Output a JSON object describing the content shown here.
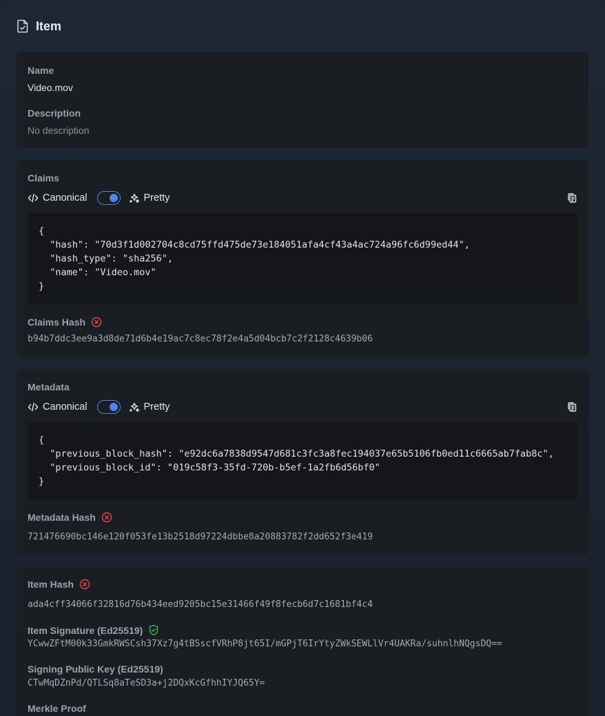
{
  "header": {
    "title": "Item",
    "icon": "file-check-icon"
  },
  "info": {
    "name_label": "Name",
    "name_value": "Video.mov",
    "description_label": "Description",
    "description_value": "No description"
  },
  "claims": {
    "section_label": "Claims",
    "canonical_label": "Canonical",
    "pretty_label": "Pretty",
    "toggle_on": true,
    "json_text": "{\n  \"hash\": \"70d3f1d002704c8cd75ffd475de73e184051afa4cf43a4ac724a96fc6d99ed44\",\n  \"hash_type\": \"sha256\",\n  \"name\": \"Video.mov\"\n}",
    "hash_label": "Claims Hash",
    "hash_status": "invalid",
    "hash_value": "b94b7ddc3ee9a3d8de71d6b4e19ac7c8ec78f2e4a5d04bcb7c2f2128c4639b06"
  },
  "metadata": {
    "section_label": "Metadata",
    "canonical_label": "Canonical",
    "pretty_label": "Pretty",
    "toggle_on": true,
    "json_text": "{\n  \"previous_block_hash\": \"e92dc6a7838d9547d681c3fc3a8fec194037e65b5106fb0ed11c6665ab7fab8c\",\n  \"previous_block_id\": \"019c58f3-35fd-720b-b5ef-1a2fb6d56bf0\"\n}",
    "hash_label": "Metadata Hash",
    "hash_status": "invalid",
    "hash_value": "721476690bc146e120f053fe13b2518d97224dbbe8a20883782f2dd652f3e419"
  },
  "item": {
    "hash_label": "Item Hash",
    "hash_status": "invalid",
    "hash_value": "ada4cff34066f32816d76b434eed9205bc15e31466f49f8fecb6d7c1681bf4c4",
    "signature_label": "Item Signature (Ed25519)",
    "signature_status": "verified",
    "signature_value": "YCwwZFtM00k33GmkRWSCsh37Xz7g4tBSscfVRhP8jt65I/mGPjT6IrYtyZWkSEWLlVr4UAKRa/suhnlhNQgsDQ==",
    "public_key_label": "Signing Public Key (Ed25519)",
    "public_key_value": "CTwMqDZnPd/QTLSq8aTeSD3a+j2DQxKcGfhhIYJQ65Y=",
    "merkle_label": "Merkle Proof"
  },
  "colors": {
    "accent": "#4f86e8",
    "error": "#e5484d",
    "success": "#3fb950",
    "card_bg": "#1a1d21",
    "code_bg": "#14161a"
  }
}
